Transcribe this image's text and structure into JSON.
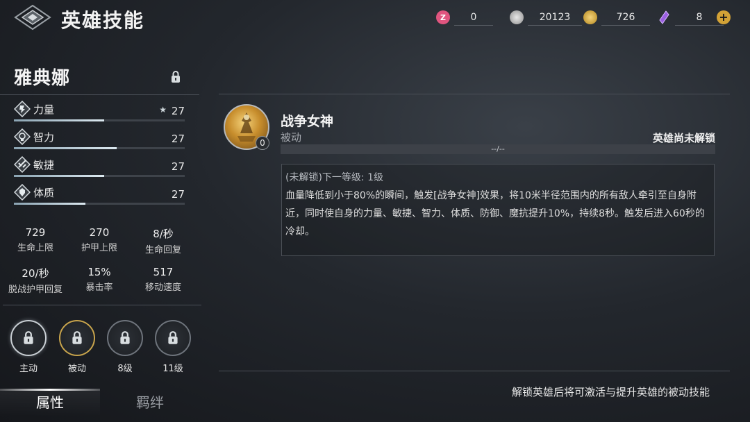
{
  "header": {
    "title": "英雄技能",
    "currencies": [
      {
        "name": "pink-token",
        "value": "0",
        "color": "#e0557f"
      },
      {
        "name": "silver-coin",
        "value": "20123",
        "color": "#c8c8c8"
      },
      {
        "name": "gold-coin",
        "value": "726",
        "color": "#d4aa3a"
      },
      {
        "name": "purple-crystal",
        "value": "8",
        "color": "#9b5fe0"
      }
    ]
  },
  "hero": {
    "name": "雅典娜",
    "stats": [
      {
        "label": "力量",
        "value": "27",
        "starred": true,
        "fill": 0.53,
        "icon": "strength-icon"
      },
      {
        "label": "智力",
        "value": "27",
        "starred": false,
        "fill": 0.6,
        "icon": "intelligence-icon"
      },
      {
        "label": "敏捷",
        "value": "27",
        "starred": false,
        "fill": 0.53,
        "icon": "agility-icon"
      },
      {
        "label": "体质",
        "value": "27",
        "starred": false,
        "fill": 0.42,
        "icon": "constitution-icon"
      }
    ],
    "attributes": [
      {
        "value": "729",
        "label": "生命上限"
      },
      {
        "value": "270",
        "label": "护甲上限"
      },
      {
        "value": "8/秒",
        "label": "生命回复"
      },
      {
        "value": "20/秒",
        "label": "脱战护甲回复"
      },
      {
        "value": "15%",
        "label": "暴击率"
      },
      {
        "value": "517",
        "label": "移动速度"
      }
    ],
    "skill_slots": [
      {
        "label": "主动"
      },
      {
        "label": "被动"
      },
      {
        "label": "8级"
      },
      {
        "label": "11级"
      }
    ]
  },
  "tabs": {
    "active": "属性",
    "inactive": "羁绊"
  },
  "skill": {
    "name": "战争女神",
    "type": "被动",
    "level": "0",
    "status": "英雄尚未解锁",
    "progress_text": "--/--",
    "next_level": "(未解锁)下一等级: 1级",
    "description": "血量降低到小于80%的瞬间，触发[战争女神]效果，将10米半径范围内的所有敌人牵引至自身附近，同时使自身的力量、敏捷、智力、体质、防御、魔抗提升10%，持续8秒。触发后进入60秒的冷却。"
  },
  "footer": {
    "hint": "解锁英雄后将可激活与提升英雄的被动技能"
  }
}
